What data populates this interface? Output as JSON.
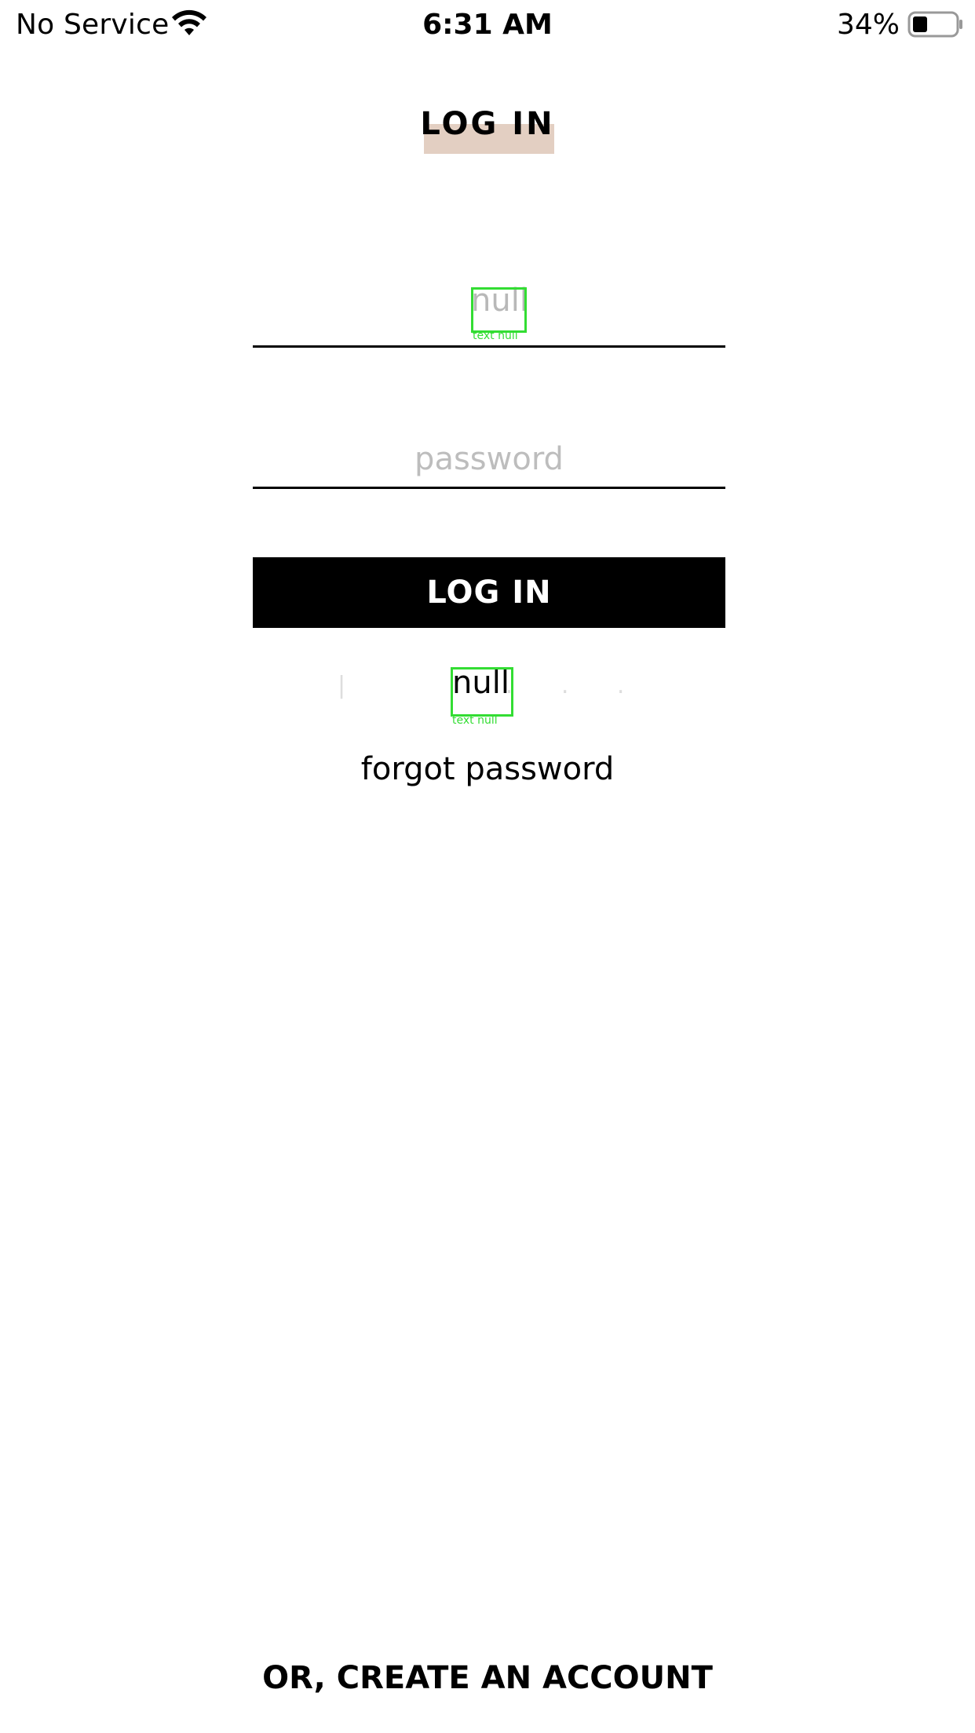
{
  "status_bar": {
    "carrier": "No Service",
    "time": "6:31 AM",
    "battery_percent": "34%",
    "battery_level": 0.34,
    "wifi_icon": "wifi-icon",
    "battery_icon": "battery-icon"
  },
  "header": {
    "title": "LOG IN",
    "highlight_color": "#e3cfc2"
  },
  "form": {
    "email_overlay_text": "null",
    "email_overlay_label": "text null",
    "password_placeholder": "password",
    "login_button_label": "LOG IN",
    "secondary_overlay_text": "null",
    "secondary_overlay_label": "text null",
    "forgot_password_label": "forgot password"
  },
  "footer": {
    "create_account_label": "OR, CREATE AN ACCOUNT"
  },
  "colors": {
    "debug_overlay": "#33dd33",
    "button_bg": "#000000",
    "placeholder": "#bdbdbd"
  }
}
